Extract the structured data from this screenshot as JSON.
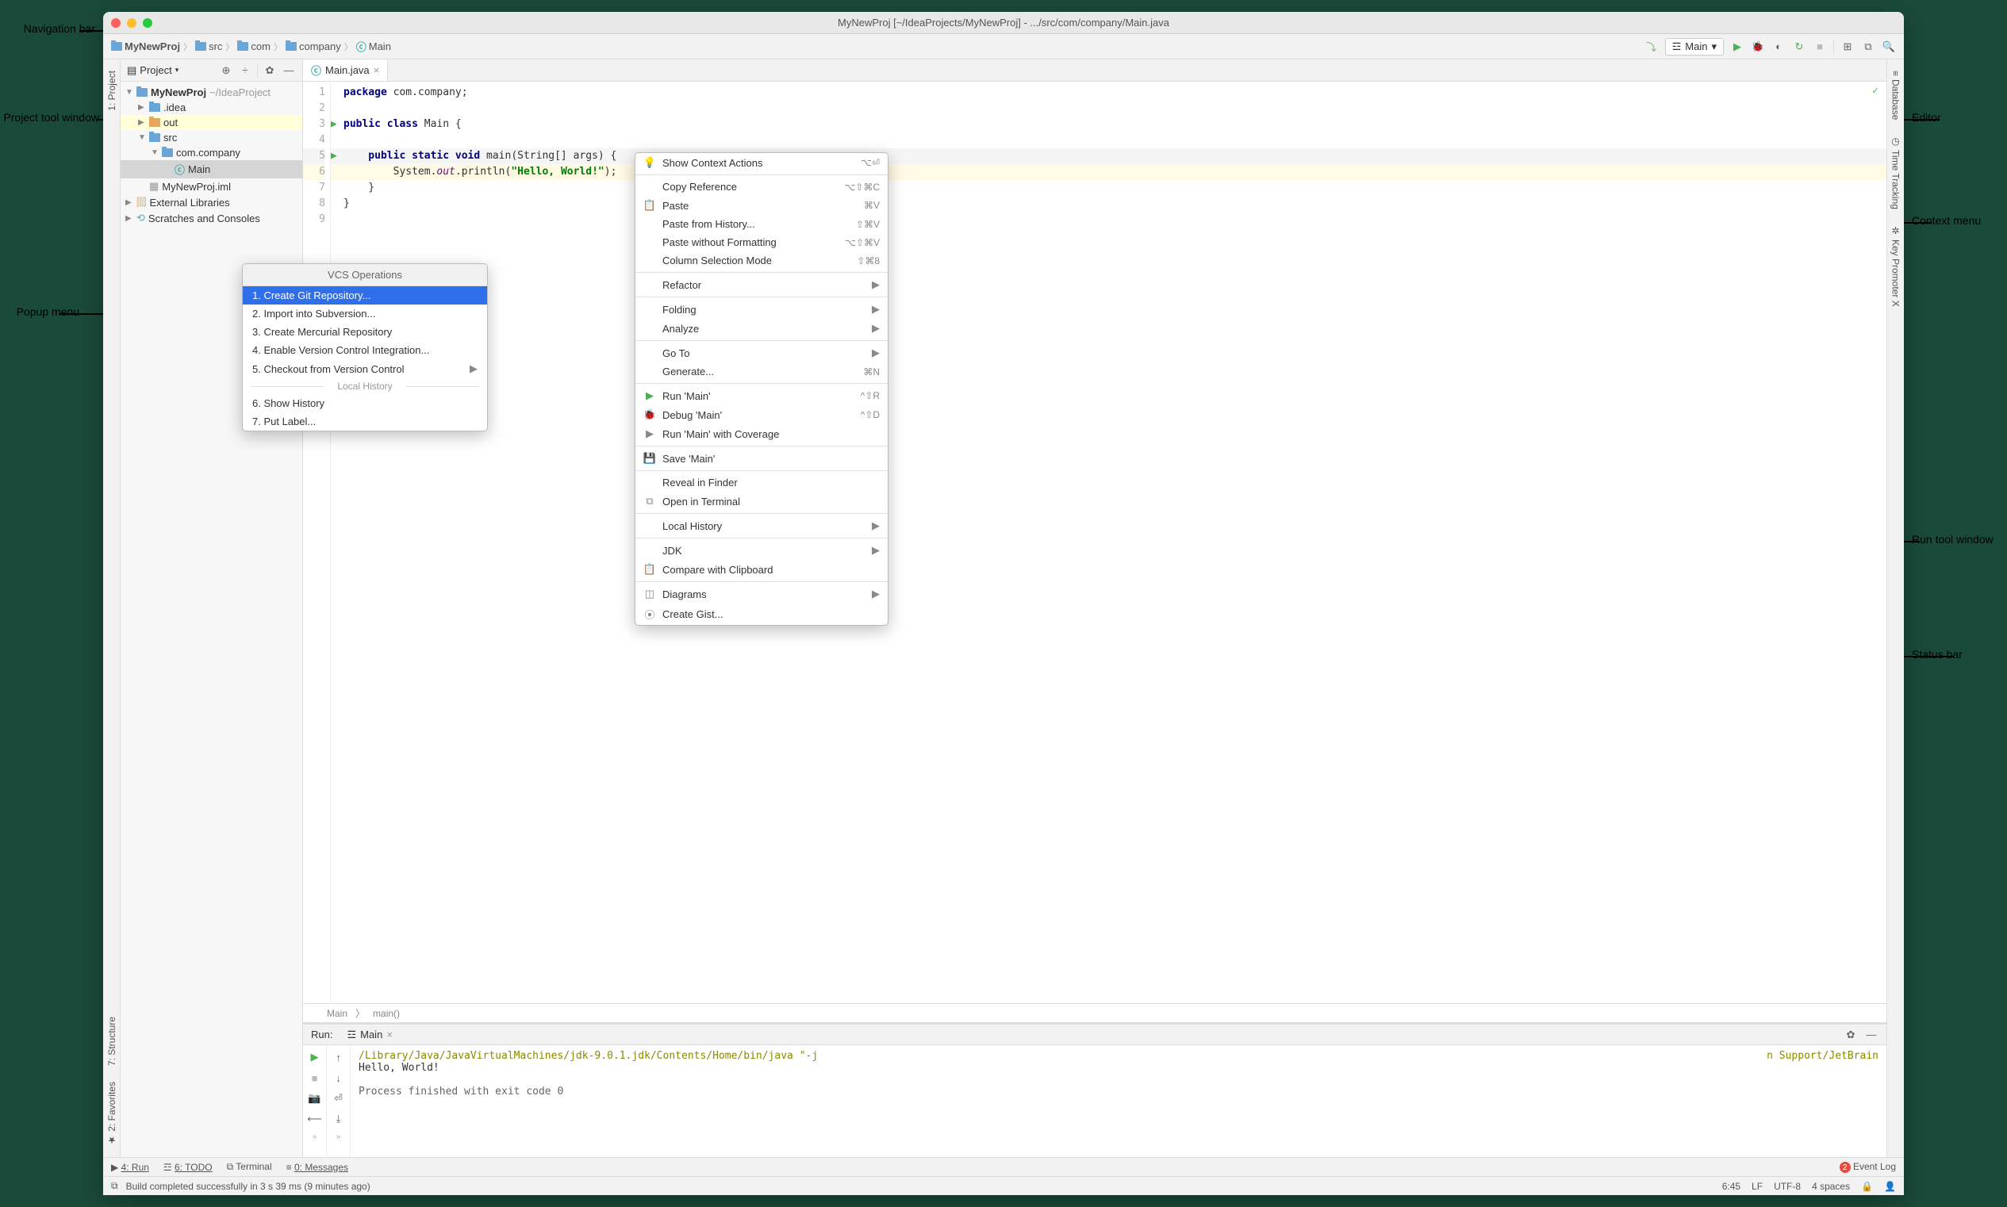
{
  "callouts": {
    "nav": "Navigation bar",
    "project": "Project tool window",
    "popup": "Popup menu",
    "editor": "Editor",
    "context": "Context menu",
    "run": "Run tool window",
    "status": "Status bar"
  },
  "window_title": "MyNewProj [~/IdeaProjects/MyNewProj] - .../src/com/company/Main.java",
  "breadcrumb": [
    "MyNewProj",
    "src",
    "com",
    "company",
    "Main"
  ],
  "run_config_name": "Main",
  "project_panel": {
    "title": "Project",
    "tree": {
      "root": "MyNewProj",
      "root_path": "~/IdeaProject",
      "idea": ".idea",
      "out": "out",
      "src": "src",
      "package": "com.company",
      "main_class": "Main",
      "iml": "MyNewProj.iml",
      "ext_lib": "External Libraries",
      "scratches": "Scratches and Consoles"
    }
  },
  "gutter_left": [
    "1: Project",
    "7: Structure",
    "2: Favorites"
  ],
  "gutter_right": [
    "Database",
    "Time Tracking",
    "Key Promoter X"
  ],
  "editor_tab": "Main.java",
  "code": {
    "l1": "package com.company;",
    "l3a": "public class ",
    "l3b": "Main {",
    "l5a": "    public static void ",
    "l5b": "main(String[] args) {",
    "l6a": "        System.",
    "l6b": "out",
    "l6c": ".println(",
    "l6d": "\"Hello, World!\"",
    "l6e": ");",
    "l7": "    }",
    "l8": "}"
  },
  "editor_breadcrumb": [
    "Main",
    "main()"
  ],
  "vcs_popup": {
    "title": "VCS Operations",
    "items": [
      "1. Create Git Repository...",
      "2. Import into Subversion...",
      "3. Create Mercurial Repository",
      "4. Enable Version Control Integration...",
      "5. Checkout from Version Control"
    ],
    "sep": "Local History",
    "history_items": [
      "6. Show History",
      "7. Put Label..."
    ]
  },
  "context_menu": [
    {
      "icon": "💡",
      "label": "Show Context Actions",
      "shortcut": "⌥⏎"
    },
    {
      "sep": true
    },
    {
      "label": "Copy Reference",
      "shortcut": "⌥⇧⌘C"
    },
    {
      "icon": "📋",
      "label": "Paste",
      "shortcut": "⌘V"
    },
    {
      "label": "Paste from History...",
      "shortcut": "⇧⌘V"
    },
    {
      "label": "Paste without Formatting",
      "shortcut": "⌥⇧⌘V"
    },
    {
      "label": "Column Selection Mode",
      "shortcut": "⇧⌘8"
    },
    {
      "sep": true
    },
    {
      "label": "Refactor",
      "submenu": true
    },
    {
      "sep": true
    },
    {
      "label": "Folding",
      "submenu": true
    },
    {
      "label": "Analyze",
      "submenu": true
    },
    {
      "sep": true
    },
    {
      "label": "Go To",
      "submenu": true
    },
    {
      "label": "Generate...",
      "shortcut": "⌘N"
    },
    {
      "sep": true
    },
    {
      "icon": "▶",
      "label": "Run 'Main'",
      "shortcut": "^⇧R",
      "color": "#4caf50"
    },
    {
      "icon": "🐞",
      "label": "Debug 'Main'",
      "shortcut": "^⇧D",
      "color": "#4caf50"
    },
    {
      "icon": "▶",
      "label": "Run 'Main' with Coverage"
    },
    {
      "sep": true
    },
    {
      "icon": "💾",
      "label": "Save 'Main'"
    },
    {
      "sep": true
    },
    {
      "label": "Reveal in Finder"
    },
    {
      "icon": "⧉",
      "label": "Open in Terminal"
    },
    {
      "sep": true
    },
    {
      "label": "Local History",
      "submenu": true
    },
    {
      "sep": true
    },
    {
      "label": "JDK",
      "submenu": true
    },
    {
      "icon": "📋",
      "label": "Compare with Clipboard"
    },
    {
      "sep": true
    },
    {
      "icon": "◫",
      "label": "Diagrams",
      "submenu": true
    },
    {
      "icon": "⦿",
      "label": "Create Gist..."
    }
  ],
  "run_panel": {
    "title": "Run:",
    "tab": "Main",
    "cmd": "/Library/Java/JavaVirtualMachines/jdk-9.0.1.jdk/Contents/Home/bin/java \"-j",
    "cmd_tail": "n Support/JetBrain",
    "output": "Hello, World!",
    "exit": "Process finished with exit code 0"
  },
  "bottom_tabs": [
    "4: Run",
    "6: TODO",
    "Terminal",
    "0: Messages"
  ],
  "status": {
    "msg": "Build completed successfully in 3 s 39 ms (9 minutes ago)",
    "event_log": "Event Log",
    "event_count": "2",
    "cursor": "6:45",
    "le": "LF",
    "enc": "UTF-8",
    "indent": "4 spaces"
  }
}
